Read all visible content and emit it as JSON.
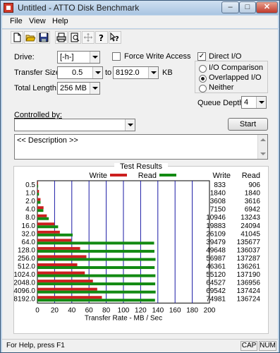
{
  "window": {
    "title": "Untitled - ATTO Disk Benchmark",
    "minimize_glyph": "–",
    "maximize_glyph": "□",
    "close_glyph": "✕"
  },
  "menu": [
    "File",
    "View",
    "Help"
  ],
  "toolbar": {
    "icons": [
      "new-icon",
      "open-icon",
      "save-icon",
      "print-icon",
      "print-preview-icon",
      "move-icon",
      "help-icon",
      "context-help-icon"
    ]
  },
  "settings": {
    "drive_label": "Drive:",
    "drive_value": "[-h-]",
    "force_write_label": "Force Write Access",
    "force_write_checked": false,
    "direct_io_label": "Direct I/O",
    "direct_io_checked": true,
    "transfer_size_label": "Transfer Size:",
    "transfer_from": "0.5",
    "to_label": "to",
    "transfer_to": "8192.0",
    "kb_label": "KB",
    "total_length_label": "Total Length:",
    "total_length_value": "256 MB",
    "io_options": [
      {
        "label": "I/O Comparison",
        "selected": false
      },
      {
        "label": "Overlapped I/O",
        "selected": true
      },
      {
        "label": "Neither",
        "selected": false
      }
    ],
    "queue_depth_label": "Queue Depth:",
    "queue_depth_value": "4",
    "controlled_by_label": "Controlled by:",
    "controlled_by_value": "",
    "start_label": "Start",
    "description": "<< Description >>"
  },
  "results": {
    "legend_title": "Test Results",
    "write_label": "Write",
    "read_label": "Read",
    "write_color": "#cc1f1f",
    "read_color": "#128a12",
    "col_write": "Write",
    "col_read": "Read"
  },
  "chart_data": {
    "type": "bar",
    "orientation": "horizontal",
    "categories": [
      "0.5",
      "1.0",
      "2.0",
      "4.0",
      "8.0",
      "16.0",
      "32.0",
      "64.0",
      "128.0",
      "256.0",
      "512.0",
      "1024.0",
      "2048.0",
      "4096.0",
      "8192.0"
    ],
    "series": [
      {
        "name": "Write",
        "values": [
          833,
          1840,
          3608,
          7150,
          10946,
          19883,
          26109,
          39479,
          49648,
          56987,
          46361,
          55120,
          64527,
          69542,
          74981
        ]
      },
      {
        "name": "Read",
        "values": [
          906,
          1840,
          3616,
          6942,
          13243,
          24094,
          41045,
          135677,
          136037,
          137287,
          136261,
          137190,
          136956,
          137424,
          136724
        ]
      }
    ],
    "xlabel": "Transfer Rate - MB / Sec",
    "xlim": [
      0,
      200
    ],
    "xticks": [
      0,
      20,
      40,
      60,
      80,
      100,
      120,
      140,
      160,
      180,
      200
    ],
    "grid": true,
    "legend": "top"
  },
  "status": {
    "text": "For Help, press F1",
    "cap": "CAP",
    "num": "NUM"
  }
}
